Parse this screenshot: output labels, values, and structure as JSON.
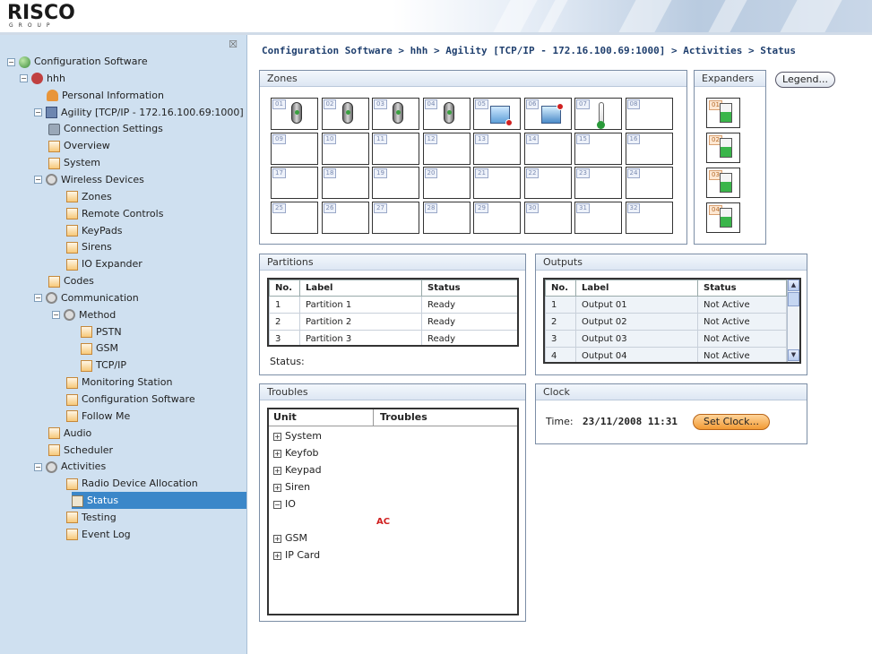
{
  "header": {
    "brand": "RISCO",
    "brand_sub": "GROUP"
  },
  "sidebar": {
    "close_icon": "close-icon",
    "items": [
      {
        "label": "Configuration Software",
        "icon": "globe-icon",
        "level": 0,
        "toggle": "-"
      },
      {
        "label": "hhh",
        "icon": "users-icon",
        "level": 1,
        "toggle": "-"
      },
      {
        "label": "Personal Information",
        "icon": "person-icon",
        "level": 2,
        "toggle": ""
      },
      {
        "label": "Agility [TCP/IP - 172.16.100.69:1000]",
        "icon": "panel-icon",
        "level": 2,
        "toggle": "-"
      },
      {
        "label": "Connection Settings",
        "icon": "plug-icon",
        "level": 3,
        "toggle": ""
      },
      {
        "label": "Overview",
        "icon": "folder-icon",
        "level": 3,
        "toggle": ""
      },
      {
        "label": "System",
        "icon": "folder-icon",
        "level": 3,
        "toggle": ""
      },
      {
        "label": "Wireless Devices",
        "icon": "gear-icon",
        "level": 3,
        "toggle": "-"
      },
      {
        "label": "Zones",
        "icon": "folder-icon",
        "level": 4,
        "toggle": ""
      },
      {
        "label": "Remote Controls",
        "icon": "folder-icon",
        "level": 4,
        "toggle": ""
      },
      {
        "label": "KeyPads",
        "icon": "folder-icon",
        "level": 4,
        "toggle": ""
      },
      {
        "label": "Sirens",
        "icon": "folder-icon",
        "level": 4,
        "toggle": ""
      },
      {
        "label": "IO Expander",
        "icon": "folder-icon",
        "level": 4,
        "toggle": ""
      },
      {
        "label": "Codes",
        "icon": "folder-icon",
        "level": 3,
        "toggle": ""
      },
      {
        "label": "Communication",
        "icon": "gear-icon",
        "level": 3,
        "toggle": "-"
      },
      {
        "label": "Method",
        "icon": "gear-icon",
        "level": 4,
        "toggle": "-"
      },
      {
        "label": "PSTN",
        "icon": "folder-icon",
        "level": 5,
        "toggle": ""
      },
      {
        "label": "GSM",
        "icon": "folder-icon",
        "level": 5,
        "toggle": ""
      },
      {
        "label": "TCP/IP",
        "icon": "folder-icon",
        "level": 5,
        "toggle": ""
      },
      {
        "label": "Monitoring Station",
        "icon": "folder-icon",
        "level": 4,
        "toggle": ""
      },
      {
        "label": "Configuration Software",
        "icon": "folder-icon",
        "level": 4,
        "toggle": ""
      },
      {
        "label": "Follow Me",
        "icon": "folder-icon",
        "level": 4,
        "toggle": ""
      },
      {
        "label": "Audio",
        "icon": "folder-icon",
        "level": 3,
        "toggle": ""
      },
      {
        "label": "Scheduler",
        "icon": "folder-icon",
        "level": 3,
        "toggle": ""
      },
      {
        "label": "Activities",
        "icon": "gear-icon",
        "level": 3,
        "toggle": "-"
      },
      {
        "label": "Radio Device Allocation",
        "icon": "folder-icon",
        "level": 4,
        "toggle": ""
      },
      {
        "label": "Status",
        "icon": "status-icon",
        "level": 4,
        "toggle": "",
        "selected": true
      },
      {
        "label": "Testing",
        "icon": "folder-icon",
        "level": 4,
        "toggle": ""
      },
      {
        "label": "Event Log",
        "icon": "folder-icon",
        "level": 4,
        "toggle": ""
      }
    ]
  },
  "breadcrumb": "Configuration Software > hhh > Agility [TCP/IP - 172.16.100.69:1000] > Activities > Status",
  "zones": {
    "title": "Zones",
    "cells": [
      {
        "num": "01",
        "device": "remote"
      },
      {
        "num": "02",
        "device": "remote"
      },
      {
        "num": "03",
        "device": "remote"
      },
      {
        "num": "04",
        "device": "remote"
      },
      {
        "num": "05",
        "device": "screen-alert"
      },
      {
        "num": "06",
        "device": "screen-alert-2"
      },
      {
        "num": "07",
        "device": "thermometer"
      },
      {
        "num": "08",
        "device": ""
      },
      {
        "num": "09",
        "device": ""
      },
      {
        "num": "10",
        "device": ""
      },
      {
        "num": "11",
        "device": ""
      },
      {
        "num": "12",
        "device": ""
      },
      {
        "num": "13",
        "device": ""
      },
      {
        "num": "14",
        "device": ""
      },
      {
        "num": "15",
        "device": ""
      },
      {
        "num": "16",
        "device": ""
      },
      {
        "num": "17",
        "device": ""
      },
      {
        "num": "18",
        "device": ""
      },
      {
        "num": "19",
        "device": ""
      },
      {
        "num": "20",
        "device": ""
      },
      {
        "num": "21",
        "device": ""
      },
      {
        "num": "22",
        "device": ""
      },
      {
        "num": "23",
        "device": ""
      },
      {
        "num": "24",
        "device": ""
      },
      {
        "num": "25",
        "device": ""
      },
      {
        "num": "26",
        "device": ""
      },
      {
        "num": "27",
        "device": ""
      },
      {
        "num": "28",
        "device": ""
      },
      {
        "num": "29",
        "device": ""
      },
      {
        "num": "30",
        "device": ""
      },
      {
        "num": "31",
        "device": ""
      },
      {
        "num": "32",
        "device": ""
      }
    ]
  },
  "expanders": {
    "title": "Expanders",
    "cells": [
      {
        "num": "01"
      },
      {
        "num": "02"
      },
      {
        "num": "03"
      },
      {
        "num": "04"
      }
    ]
  },
  "legend_button": "Legend...",
  "partitions": {
    "title": "Partitions",
    "columns": [
      "No.",
      "Label",
      "Status"
    ],
    "rows": [
      {
        "no": "1",
        "label": "Partition 1",
        "status": "Ready"
      },
      {
        "no": "2",
        "label": "Partition 2",
        "status": "Ready"
      },
      {
        "no": "3",
        "label": "Partition 3",
        "status": "Ready"
      }
    ],
    "status_label": "Status:"
  },
  "outputs": {
    "title": "Outputs",
    "columns": [
      "No.",
      "Label",
      "Status"
    ],
    "rows": [
      {
        "no": "1",
        "label": "Output 01",
        "status": "Not Active"
      },
      {
        "no": "2",
        "label": "Output 02",
        "status": "Not Active"
      },
      {
        "no": "3",
        "label": "Output 03",
        "status": "Not Active"
      },
      {
        "no": "4",
        "label": "Output 04",
        "status": "Not Active"
      }
    ]
  },
  "troubles": {
    "title": "Troubles",
    "columns": [
      "Unit",
      "Troubles"
    ],
    "nodes": [
      {
        "label": "System",
        "toggle": "+"
      },
      {
        "label": "Keyfob",
        "toggle": "+"
      },
      {
        "label": "Keypad",
        "toggle": "+"
      },
      {
        "label": "Siren",
        "toggle": "+"
      },
      {
        "label": "IO",
        "toggle": "-"
      },
      {
        "label": "GSM",
        "toggle": "+"
      },
      {
        "label": "IP Card",
        "toggle": "+"
      }
    ],
    "io_trouble": "AC"
  },
  "clock": {
    "title": "Clock",
    "time_label": "Time:",
    "time_value": "23/11/2008 11:31",
    "set_button": "Set Clock..."
  },
  "colors": {
    "sidebar_bg": "#cfe0f0",
    "selection": "#3b87c9",
    "breadcrumb": "#1f3f6e",
    "trouble_red": "#d02020",
    "accent_orange": "#f29a34"
  }
}
